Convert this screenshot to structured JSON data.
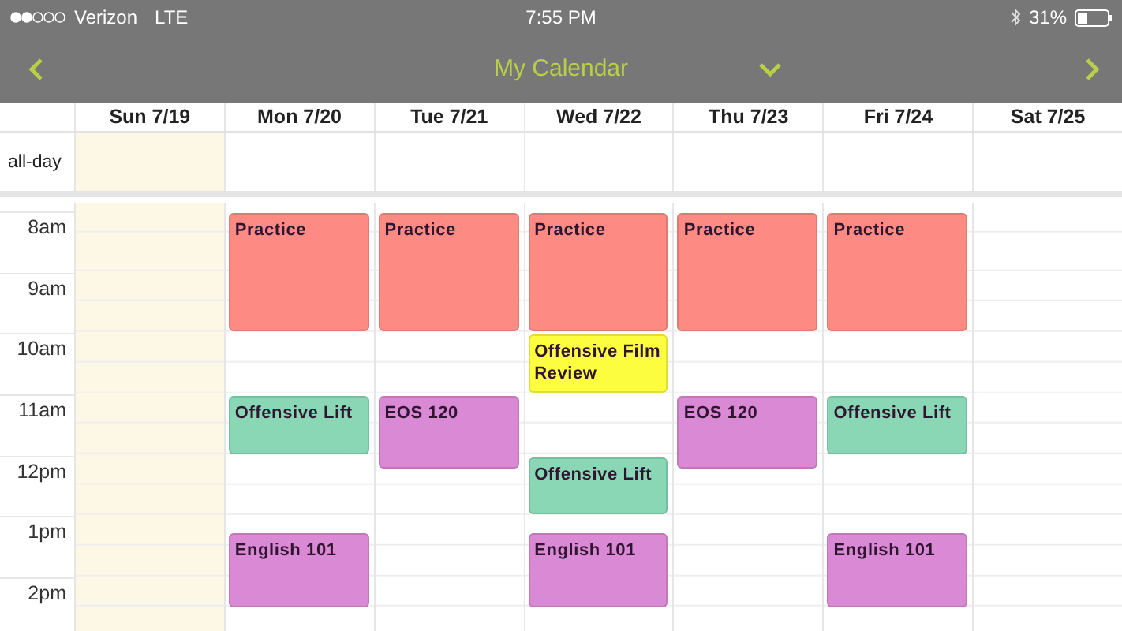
{
  "status_bar": {
    "carrier": "Verizon",
    "network": "LTE",
    "time": "7:55 PM",
    "battery": "31%"
  },
  "nav": {
    "title": "My Calendar"
  },
  "all_day_label": "all-day",
  "hours": [
    "8am",
    "9am",
    "10am",
    "11am",
    "12pm",
    "1pm",
    "2pm"
  ],
  "days": [
    {
      "label": "Sun 7/19",
      "today": true
    },
    {
      "label": "Mon 7/20",
      "today": false,
      "blocks": [
        {
          "kind": "double",
          "title": "Practice",
          "color": "#fe8a84"
        },
        {
          "kind": "hour"
        },
        {
          "kind": "hour",
          "title": "Offensive Lift",
          "color": "#8ad7b6"
        },
        {
          "kind": "extended"
        },
        {
          "kind": "extended",
          "title": "English 101",
          "color": "#da8ad4"
        }
      ]
    },
    {
      "label": "Tue 7/21",
      "today": false,
      "blocks": [
        {
          "kind": "double",
          "title": "Practice",
          "color": "#fe8a84"
        },
        {
          "kind": "hour"
        },
        {
          "kind": "extended",
          "title": "EOS 120",
          "color": "#da8ad4"
        }
      ]
    },
    {
      "label": "Wed 7/22",
      "today": false,
      "blocks": [
        {
          "kind": "double",
          "title": "Practice",
          "color": "#fe8a84"
        },
        {
          "kind": "hour",
          "title": "Offensive Film Review",
          "color": "#fdfd40"
        },
        {
          "kind": "hour"
        },
        {
          "kind": "hour",
          "title": "Offensive Lift",
          "color": "#8ad7b6"
        },
        {
          "kind": "quarter"
        },
        {
          "kind": "extended",
          "title": "English 101",
          "color": "#da8ad4"
        }
      ]
    },
    {
      "label": "Thu 7/23",
      "today": false,
      "blocks": [
        {
          "kind": "double",
          "title": "Practice",
          "color": "#fe8a84"
        },
        {
          "kind": "hour"
        },
        {
          "kind": "extended",
          "title": "EOS 120",
          "color": "#da8ad4"
        }
      ]
    },
    {
      "label": "Fri 7/24",
      "today": false,
      "blocks": [
        {
          "kind": "double",
          "title": "Practice",
          "color": "#fe8a84"
        },
        {
          "kind": "hour"
        },
        {
          "kind": "hour",
          "title": "Offensive Lift",
          "color": "#8ad7b6"
        },
        {
          "kind": "extended"
        },
        {
          "kind": "extended",
          "title": "English 101",
          "color": "#da8ad4"
        }
      ]
    },
    {
      "label": "Sat 7/25",
      "today": false
    }
  ]
}
